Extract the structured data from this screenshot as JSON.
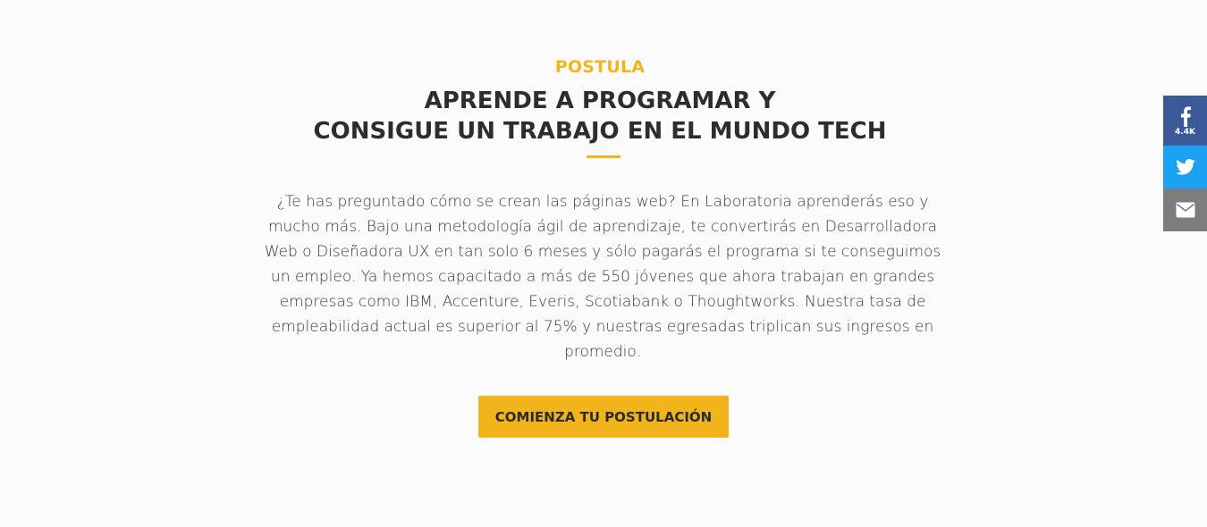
{
  "section": {
    "eyebrow": "POSTULA",
    "headline_line1": "APRENDE A PROGRAMAR Y",
    "headline_line2": "CONSIGUE UN TRABAJO EN EL MUNDO TECH",
    "description": "¿Te has preguntado cómo se crean las páginas web? En Laboratoria aprenderás eso y mucho más. Bajo una metodología ágil de aprendizaje, te convertirás en Desarrolladora Web o Diseñadora UX en tan solo 6 meses y sólo pagarás el programa si te conseguimos un empleo. Ya hemos capacitado a más de 550 jóvenes que ahora trabajan en grandes empresas como IBM, Accenture, Everis, Scotiabank o Thoughtworks. Nuestra tasa de empleabilidad actual es superior al 75% y nuestras egresadas triplican sus ingresos en promedio.",
    "cta_label": "COMIENZA TU POSTULACIÓN"
  },
  "share_bar": {
    "facebook": {
      "icon": "facebook-icon",
      "count": "4.4K",
      "color": "#3b5998"
    },
    "twitter": {
      "icon": "twitter-icon",
      "color": "#1da1f2"
    },
    "email": {
      "icon": "envelope-icon",
      "color": "#7d7d7d"
    }
  },
  "colors": {
    "accent": "#f0b51f",
    "background": "#fcfbfb",
    "text": "#2d2d2d"
  }
}
